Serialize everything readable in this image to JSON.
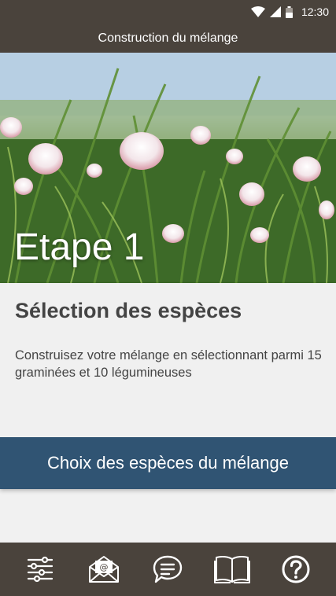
{
  "status_bar": {
    "time": "12:30",
    "icons": [
      "wifi-icon",
      "cellular-signal-icon",
      "battery-icon"
    ]
  },
  "header": {
    "title": "Construction du mélange"
  },
  "hero": {
    "image": "clover-meadow-photo",
    "step_title": "Etape 1"
  },
  "card": {
    "title": "Sélection des espèces",
    "description": "Construisez votre mélange en sélectionnant parmi 15 graminées et 10 légumineuses",
    "button_label": "Choix des espèces du mélange"
  },
  "bottom_nav": {
    "items": [
      "sliders-icon",
      "email-icon",
      "chat-icon",
      "book-icon",
      "help-icon"
    ]
  },
  "colors": {
    "app_bar": "#4a433c",
    "button": "#305473",
    "background": "#f1f1f1",
    "text": "#444444"
  }
}
